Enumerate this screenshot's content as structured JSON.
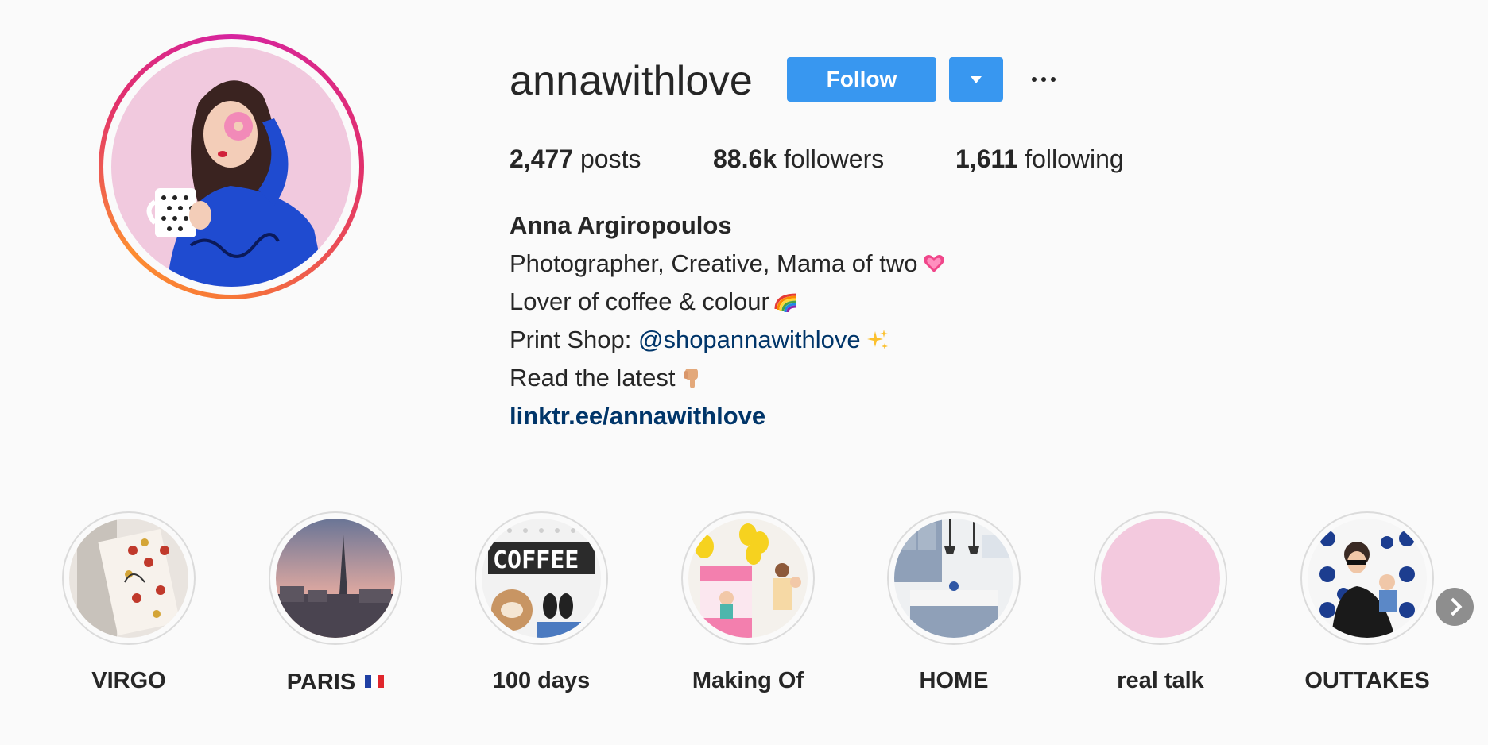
{
  "profile": {
    "username": "annawithlove",
    "follow_label": "Follow",
    "more_icon": "ellipsis-icon",
    "dropdown_icon": "caret-down-icon"
  },
  "stats": {
    "posts_count": "2,477",
    "posts_label": "posts",
    "followers_count": "88.6k",
    "followers_label": "followers",
    "following_count": "1,611",
    "following_label": "following"
  },
  "bio": {
    "full_name": "Anna Argiropoulos",
    "line1": "Photographer, Creative, Mama of two",
    "line1_emoji": "heart-icon",
    "line2": "Lover of coffee & colour",
    "line2_emoji": "rainbow-icon",
    "line3_prefix": "Print Shop: ",
    "line3_mention": "@shopannawithlove",
    "line3_emoji": "sparkles-icon",
    "line4": "Read the latest",
    "line4_emoji": "pointing-down-icon",
    "link": "linktr.ee/annawithlove"
  },
  "highlights": [
    {
      "label": "VIRGO"
    },
    {
      "label": "PARIS",
      "flag": "france-flag-icon"
    },
    {
      "label": "100 days"
    },
    {
      "label": "Making Of"
    },
    {
      "label": "HOME"
    },
    {
      "label": "real talk"
    },
    {
      "label": "OUTTAKES"
    }
  ],
  "colors": {
    "background": "#fafafa",
    "button_blue": "#3897f0",
    "link_blue": "#003569",
    "text": "#262626",
    "highlight_border": "#dbdbdb"
  }
}
